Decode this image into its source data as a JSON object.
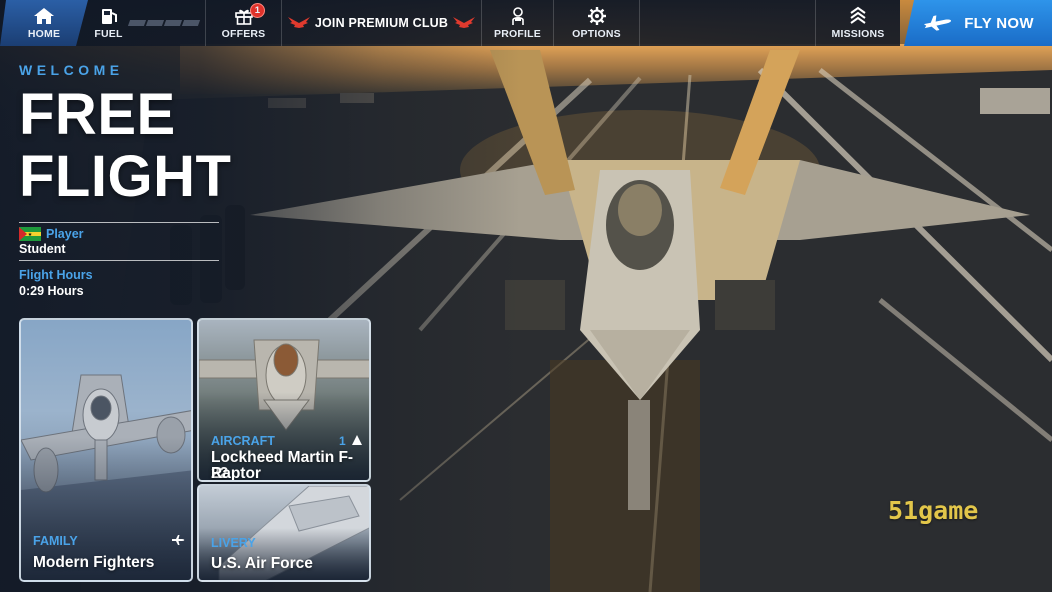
{
  "nav": {
    "home": {
      "label": "HOME",
      "icon": "home-icon"
    },
    "fuel": {
      "label": "FUEL",
      "icon": "fuel-pump-icon",
      "level": 0
    },
    "offers": {
      "label": "OFFERS",
      "icon": "gift-icon",
      "badge": "1"
    },
    "premium": {
      "label": "JOIN PREMIUM CLUB",
      "icon": "wings-emblem-icon"
    },
    "profile": {
      "label": "PROFILE",
      "icon": "pilot-icon"
    },
    "options": {
      "label": "OPTIONS",
      "icon": "gear-icon"
    },
    "missions": {
      "label": "MISSIONS",
      "icon": "rank-chevrons-icon"
    }
  },
  "fly_now": {
    "label": "FLY NOW",
    "icon": "airplane-icon"
  },
  "main": {
    "welcome": "WELCOME",
    "title_line1": "FREE",
    "title_line2": "FLIGHT"
  },
  "player": {
    "label": "Player",
    "rank": "Student",
    "flag_icon": "flag-icon",
    "flight_hours_label": "Flight Hours",
    "flight_hours_value": "0:29 Hours"
  },
  "cards": {
    "family": {
      "caption": "FAMILY",
      "name": "Modern Fighters",
      "icon": "airplane-icon"
    },
    "aircraft": {
      "caption": "AIRCRAFT",
      "name_line1": "Lockheed Martin F-22",
      "name_line2": "Raptor",
      "count": "1",
      "icon": "aircraft-silhouette-icon"
    },
    "livery": {
      "caption": "LIVERY",
      "name": "U.S. Air Force"
    }
  },
  "watermark": "51game",
  "colors": {
    "accent": "#4aa3e8",
    "home_tab": "#2b5fa6",
    "fly_now": "#1f7fdd",
    "badge": "#e0322b",
    "watermark": "#e2c64a"
  }
}
